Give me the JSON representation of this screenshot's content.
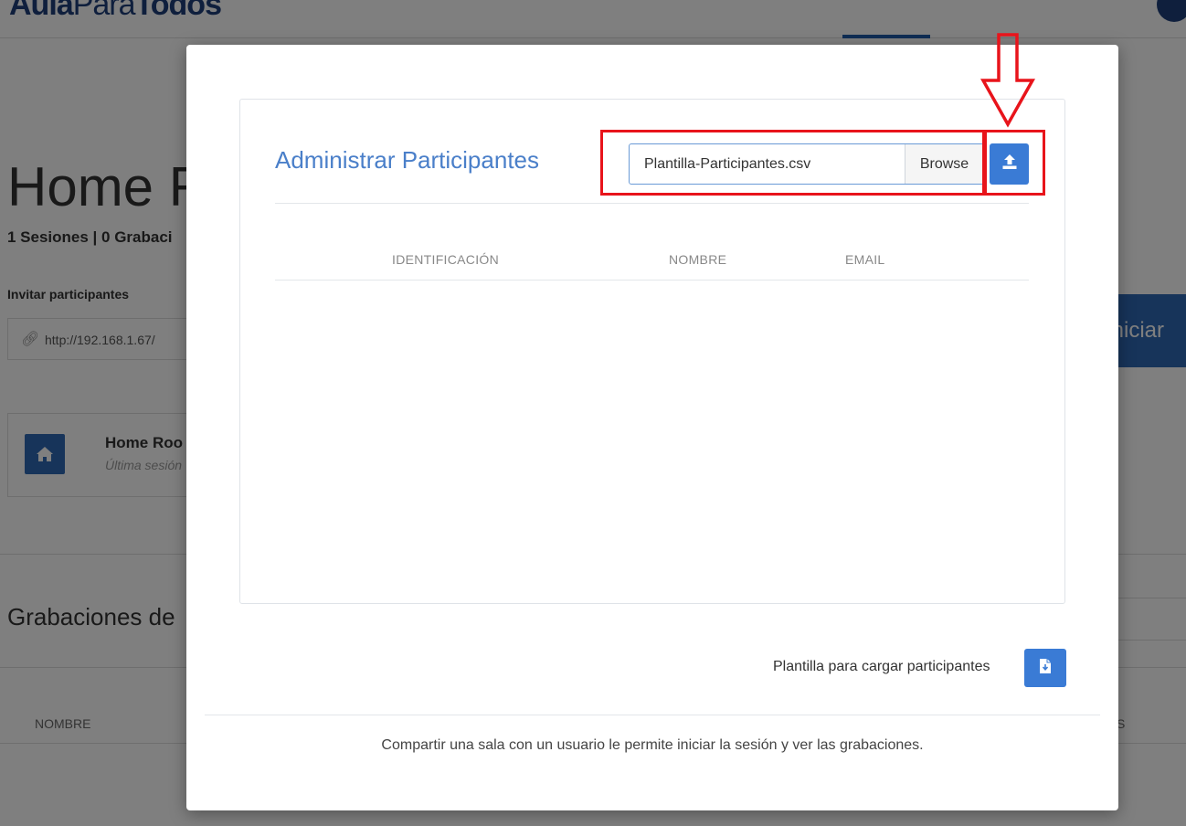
{
  "background": {
    "logo_bold": "Aula",
    "logo_thin": "Para",
    "logo_bold2": "Todos",
    "home_title": "Home R",
    "stats": "1 Sesiones | 0 Grabaci",
    "invite_label": "Invitar participantes",
    "invite_url": "http://192.168.1.67/",
    "start_button": "Iniciar",
    "room_name": "Home Roo",
    "room_last_session": "Última sesión",
    "recordings_title": "Grabaciones de",
    "recordings_col_name": "NOMBRE",
    "recordings_col_right": "S"
  },
  "modal": {
    "card_title": "Administrar Participantes",
    "file_name": "Plantilla-Participantes.csv",
    "browse_label": "Browse",
    "upload_icon": "upload-icon",
    "columns": [
      "IDENTIFICACIÓN",
      "NOMBRE",
      "EMAIL"
    ],
    "rows": [],
    "template_label": "Plantilla para cargar participantes",
    "template_icon": "file-download-icon",
    "footer_text": "Compartir una sala con un usuario le permite iniciar la sesión y ver las grabaciones."
  },
  "colors": {
    "accent": "#3a7bd5",
    "title_blue": "#4a7fc9",
    "annotation_red": "#e8141b"
  }
}
